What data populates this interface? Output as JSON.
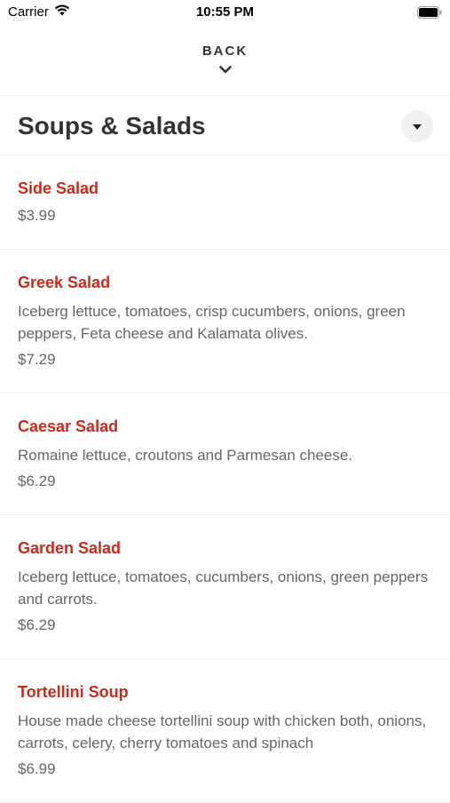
{
  "status_bar": {
    "carrier": "Carrier",
    "time": "10:55 PM"
  },
  "nav": {
    "back_label": "BACK"
  },
  "section": {
    "title": "Soups & Salads"
  },
  "items": [
    {
      "name": "Side Salad",
      "description": "",
      "price": "$3.99"
    },
    {
      "name": "Greek Salad",
      "description": "Iceberg lettuce, tomatoes, crisp cucumbers, onions, green peppers, Feta cheese and Kalamata olives.",
      "price": "$7.29"
    },
    {
      "name": "Caesar Salad",
      "description": "Romaine lettuce, croutons and Parmesan cheese.",
      "price": "$6.29"
    },
    {
      "name": "Garden Salad",
      "description": "Iceberg lettuce, tomatoes, cucumbers, onions, green peppers and carrots.",
      "price": "$6.29"
    },
    {
      "name": "Tortellini Soup",
      "description": "House made cheese tortellini soup with chicken both, onions, carrots, celery, cherry tomatoes and spinach",
      "price": "$6.99"
    }
  ],
  "colors": {
    "accent": "#cc2a1a",
    "text_muted": "#666666"
  }
}
